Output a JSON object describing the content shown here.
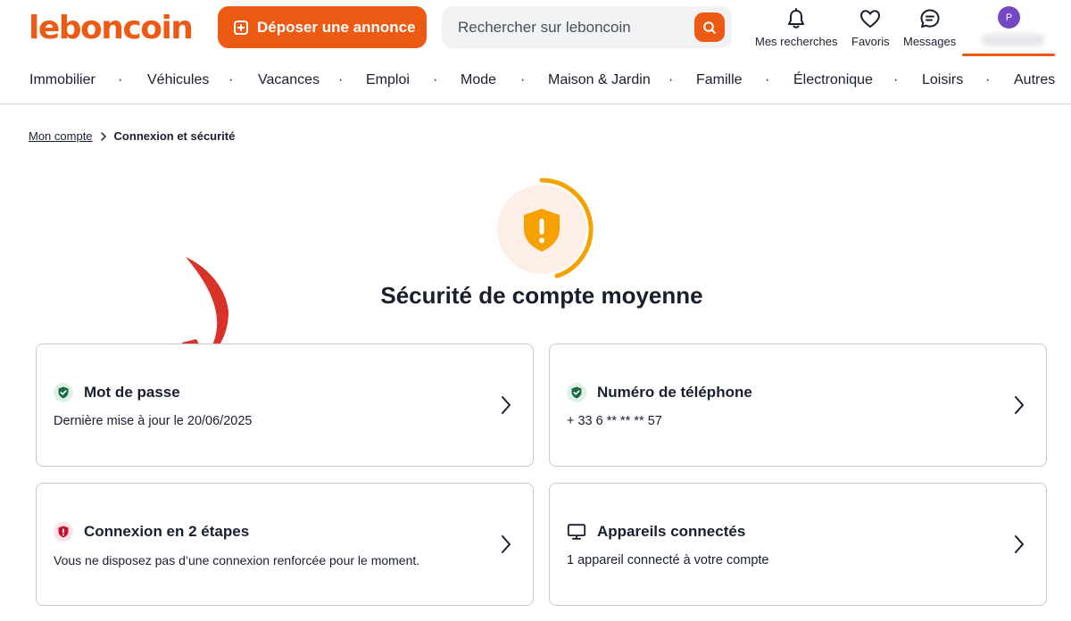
{
  "header": {
    "logo": "leboncoin",
    "post_button": "Déposer une annonce",
    "search_placeholder": "Rechercher sur leboncoin",
    "nav": [
      {
        "label": "Mes recherches",
        "icon": "bell-icon"
      },
      {
        "label": "Favoris",
        "icon": "heart-icon"
      },
      {
        "label": "Messages",
        "icon": "chat-bubble-icon"
      }
    ],
    "avatar_initial": "P",
    "accent_color": "#ec5a13"
  },
  "categories": [
    "Immobilier",
    "Véhicules",
    "Vacances",
    "Emploi",
    "Mode",
    "Maison & Jardin",
    "Famille",
    "Électronique",
    "Loisirs",
    "Autres"
  ],
  "breadcrumb": {
    "parent": "Mon compte",
    "current": "Connexion et sécurité"
  },
  "security": {
    "status_title": "Sécurité de compte moyenne",
    "status_color": "#f5a100",
    "level": 0.45
  },
  "cards": {
    "password": {
      "title": "Mot de passe",
      "subtitle": "Dernière mise à jour le 20/06/2025",
      "icon": "shield-check-icon",
      "status_color": "#1d6b45"
    },
    "phone": {
      "title": "Numéro de téléphone",
      "subtitle": "+ 33 6 ** ** ** 57",
      "icon": "shield-check-icon",
      "status_color": "#1d6b45"
    },
    "two_step": {
      "title": "Connexion en 2 étapes",
      "subtitle": "Vous ne disposez pas d’une connexion renforcée pour le moment.",
      "icon": "shield-alert-icon",
      "status_color": "#c8102e"
    },
    "devices": {
      "title": "Appareils connectés",
      "subtitle": "1 appareil connecté à votre compte",
      "icon": "monitor-icon"
    }
  }
}
